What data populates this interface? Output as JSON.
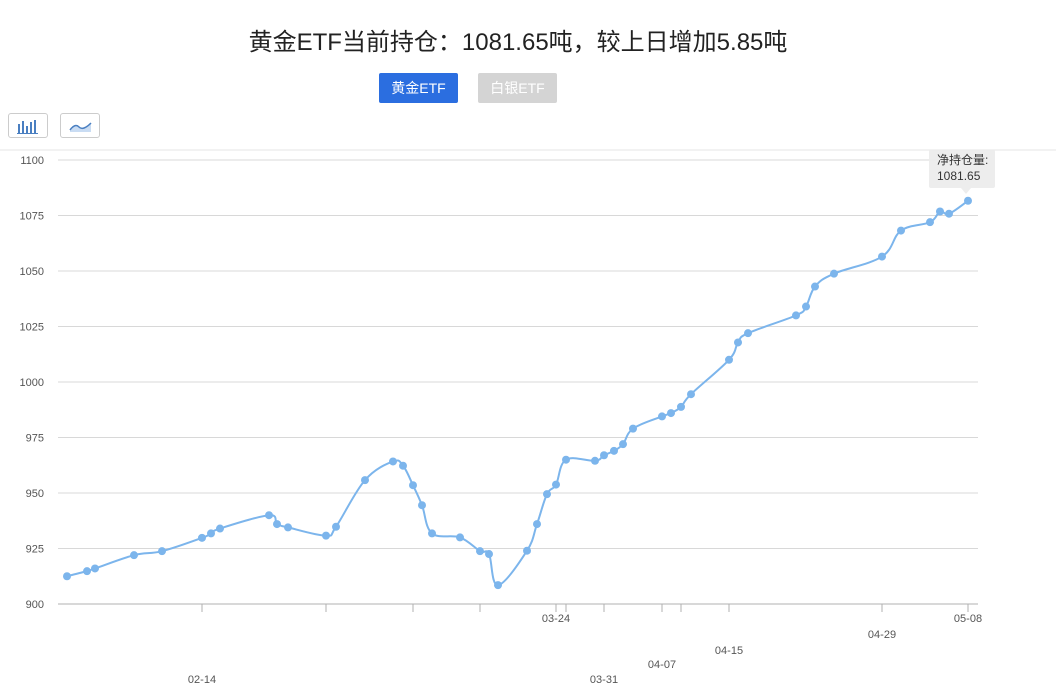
{
  "title": "黄金ETF当前持仓：1081.65吨，较上日增加5.85吨",
  "tabs": [
    {
      "label": "黄金ETF",
      "active": true
    },
    {
      "label": "白银ETF",
      "active": false
    }
  ],
  "toolbar": {
    "bar_icon": "bar-chart-icon",
    "line_icon": "line-chart-icon"
  },
  "colors": {
    "series": "#7cb5ec",
    "active_tab": "#2b6ee0",
    "inactive_tab": "#d4d4d4",
    "grid": "#d8d8d8"
  },
  "tooltip": {
    "label": "净持仓量:",
    "value": "1081.65"
  },
  "chart_data": {
    "type": "line",
    "ylim": [
      900,
      1100
    ],
    "yticks": [
      900,
      925,
      950,
      975,
      1000,
      1025,
      1050,
      1075,
      1100
    ],
    "grid": true,
    "xlabels": [
      {
        "label": "02-14",
        "index": 5,
        "row": 2
      },
      {
        "label": "03-24",
        "index": 26,
        "row": 0
      },
      {
        "label": "03-31",
        "index": 29,
        "row": 2
      },
      {
        "label": "04-07",
        "index": 33,
        "row": 1
      },
      {
        "label": "04-15",
        "index": 37,
        "row": 0
      },
      {
        "label": "04-29",
        "index": 44,
        "row": 1
      },
      {
        "label": "05-08",
        "index": 49,
        "row": 0
      }
    ],
    "extra_ticks": [
      11,
      16,
      20,
      27,
      35
    ],
    "series": [
      {
        "values": [
          912.5,
          914.8,
          916.0,
          922.0,
          923.8,
          929.8,
          931.8,
          934.0,
          940.0,
          936.0,
          934.5,
          930.8,
          934.8,
          955.8,
          964.2,
          962.3,
          953.5,
          944.5,
          931.8,
          930.0,
          923.8,
          922.5,
          908.5,
          924.0,
          936.0,
          949.5,
          953.8,
          965.0,
          964.5,
          967.0,
          969.0,
          972.0,
          979.0,
          984.5,
          986.0,
          988.8,
          994.5,
          1010.0,
          1017.8,
          1022.0,
          1030.0,
          1034.0,
          1043.0,
          1048.8,
          1056.5,
          1068.2,
          1072.0,
          1076.8,
          1075.8,
          1081.65
        ],
        "x": [
          67,
          87,
          95,
          134,
          162,
          202,
          211,
          220,
          269,
          277,
          288,
          326,
          336,
          365,
          393,
          403,
          413,
          422,
          432,
          460,
          480,
          489,
          498,
          527,
          537,
          547,
          556,
          566,
          595,
          604,
          614,
          623,
          633,
          662,
          671,
          681,
          691,
          729,
          738,
          748,
          796,
          806,
          815,
          834,
          882,
          901,
          930,
          940,
          949,
          968
        ]
      }
    ]
  }
}
